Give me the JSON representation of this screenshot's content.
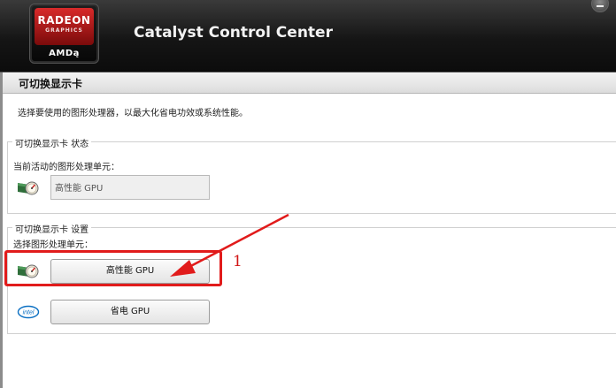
{
  "window": {
    "title": "Catalyst Control Center",
    "logo": {
      "brand": "RADEON",
      "subbrand": "GRAPHICS",
      "maker": "AMDą"
    }
  },
  "page": {
    "title": "可切换显示卡",
    "description": "选择要使用的图形处理器，以最大化省电功效或系统性能。"
  },
  "status_group": {
    "legend": "可切换显示卡 状态",
    "current_label": "当前活动的图形处理单元：",
    "current_value": "高性能 GPU",
    "icon": "amd-gpu-icon"
  },
  "settings_group": {
    "legend": "可切换显示卡 设置",
    "select_label": "选择图形处理单元：",
    "options": [
      {
        "label": "高性能 GPU",
        "icon": "amd-gpu-icon"
      },
      {
        "label": "省电 GPU",
        "icon": "intel-icon"
      }
    ]
  },
  "annotation": {
    "number": "1",
    "color": "#e11b1b"
  },
  "colors": {
    "header_bg": "#151515",
    "amd_red": "#d82a2a",
    "annotation_red": "#e11b1b"
  }
}
